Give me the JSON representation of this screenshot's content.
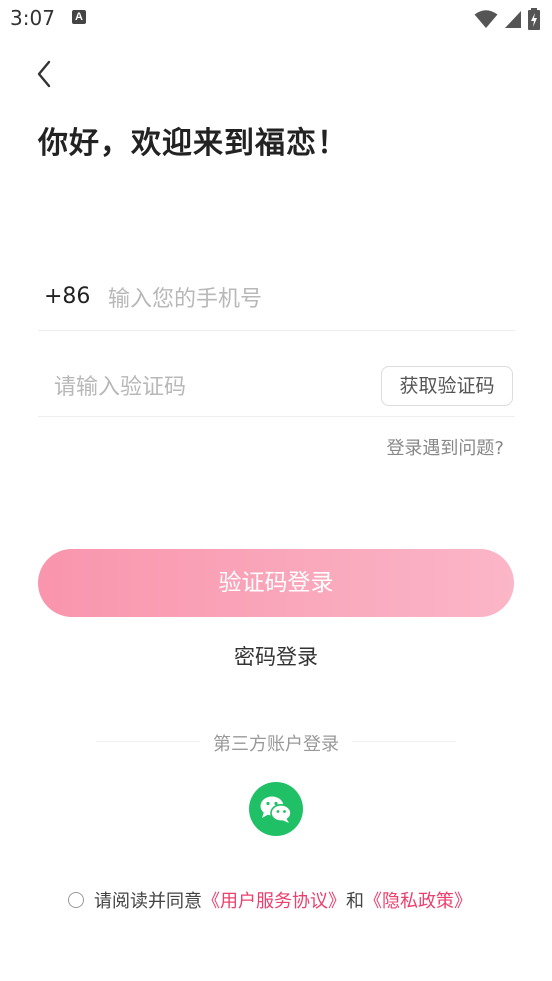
{
  "status_bar": {
    "time": "3:07",
    "notification_icon": "A"
  },
  "header": {
    "back_icon": "chevron-left-icon"
  },
  "title": "你好，欢迎来到福恋！",
  "phone": {
    "country_code": "+86",
    "placeholder": "输入您的手机号"
  },
  "code": {
    "placeholder": "请输入验证码",
    "get_code_label": "获取验证码"
  },
  "trouble_link": "登录遇到问题?",
  "login_button": "验证码登录",
  "password_login": "密码登录",
  "third_party": {
    "label": "第三方账户登录",
    "wechat_icon": "wechat-icon"
  },
  "agreement": {
    "prefix": "请阅读并同意",
    "user_agreement": "《用户服务协议》",
    "and": "和",
    "privacy_policy": "《隐私政策》"
  },
  "colors": {
    "accent": "#ec3f6e",
    "button_start": "#f995ad",
    "button_end": "#fbb6c7",
    "wechat_green": "#1fc066"
  }
}
